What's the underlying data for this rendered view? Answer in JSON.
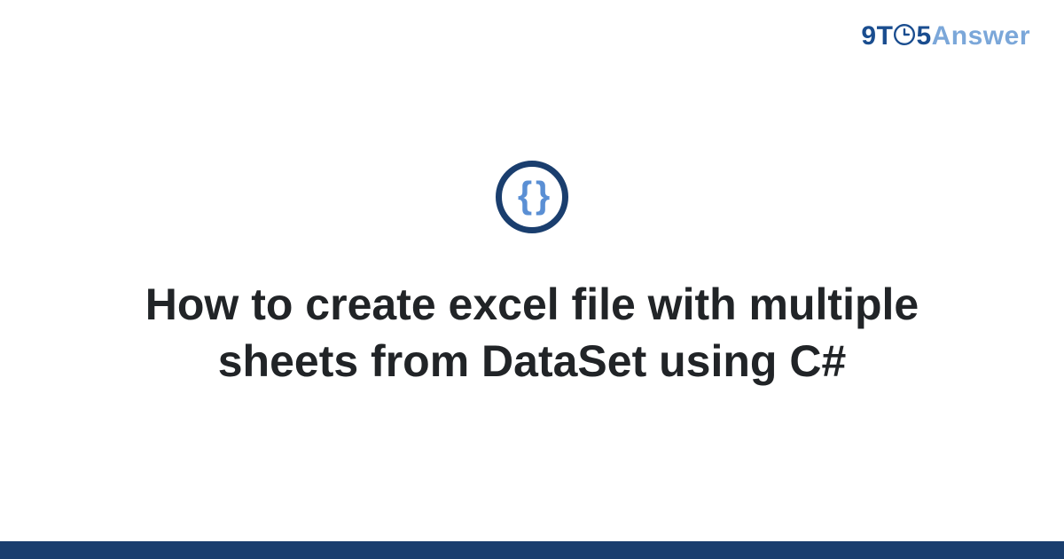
{
  "logo": {
    "part1": "9T",
    "part2": "5",
    "part3": "Answer"
  },
  "icon": {
    "glyph": "{ }",
    "name": "code-braces"
  },
  "title": "How to create excel file with multiple sheets from DataSet using C#",
  "colors": {
    "brand_dark": "#1a3e6e",
    "brand_mid": "#1a4d8f",
    "brand_light": "#7ba7d9",
    "brace": "#5a8fd4",
    "text": "#212427"
  }
}
